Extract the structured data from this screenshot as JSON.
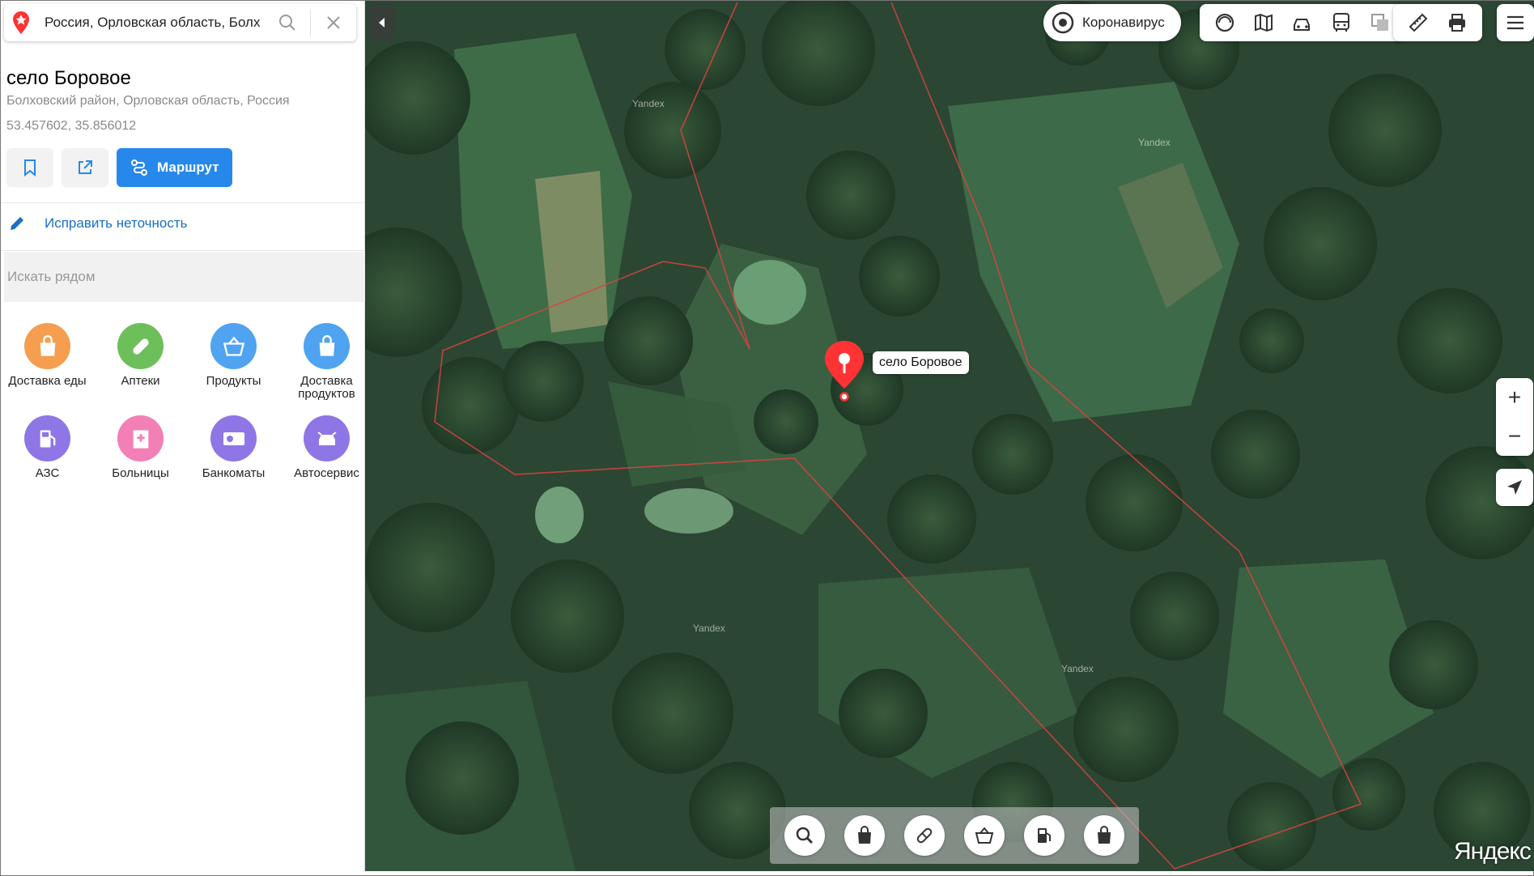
{
  "search": {
    "value": "Россия, Орловская область, Болх"
  },
  "place": {
    "title": "село Боровое",
    "address": "Болховский район, Орловская область, Россия",
    "coords": "53.457602, 35.856012"
  },
  "actions": {
    "route_label": "Маршрут"
  },
  "fix": {
    "label": "Исправить неточность"
  },
  "nearby": {
    "label": "Искать рядом"
  },
  "categories": [
    {
      "label": "Доставка еды",
      "color": "#f59e4f",
      "icon": "bag-icon"
    },
    {
      "label": "Аптеки",
      "color": "#6dbf5a",
      "icon": "pill-icon"
    },
    {
      "label": "Продукты",
      "color": "#4fa3f0",
      "icon": "basket-icon"
    },
    {
      "label": "Доставка продуктов",
      "color": "#4fa3f0",
      "icon": "bag-icon"
    },
    {
      "label": "АЗС",
      "color": "#8f76e6",
      "icon": "fuel-icon"
    },
    {
      "label": "Больницы",
      "color": "#f27fb6",
      "icon": "hospital-icon"
    },
    {
      "label": "Банкоматы",
      "color": "#8f76e6",
      "icon": "atm-icon"
    },
    {
      "label": "Автосервис",
      "color": "#8f76e6",
      "icon": "car-service-icon"
    }
  ],
  "map": {
    "corona_label": "Коронавирус",
    "marker_label": "село Боровое",
    "watermark": "Yandex",
    "logo": "Яндекс",
    "zoom_in": "+",
    "zoom_out": "−"
  },
  "colors": {
    "accent": "#2688eb",
    "marker": "#f33",
    "boundary": "#d9433f",
    "link": "#1a6fc4"
  }
}
